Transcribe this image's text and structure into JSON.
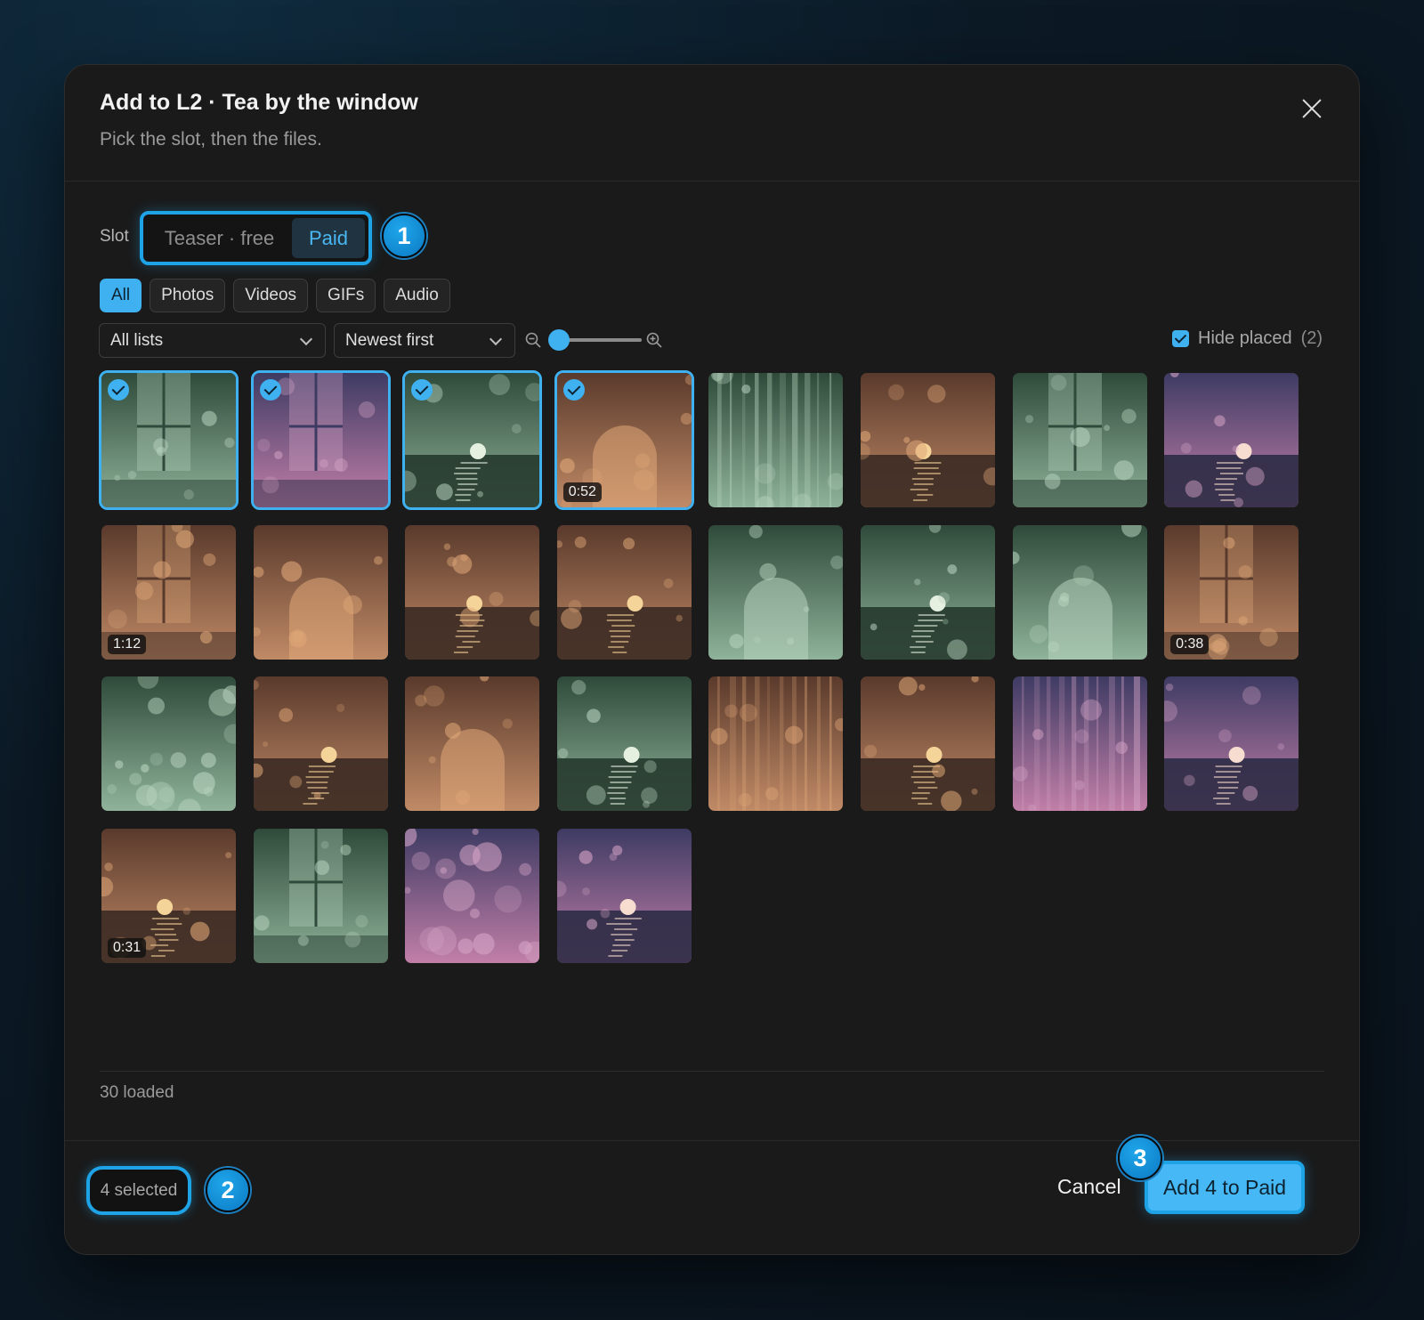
{
  "dialog": {
    "title": "Add to L2 · Tea by the window",
    "subtitle": "Pick the slot, then the files."
  },
  "slot": {
    "label": "Slot",
    "options": [
      "Teaser · free",
      "Paid"
    ],
    "selected": "Paid"
  },
  "steps": [
    "1",
    "2",
    "3"
  ],
  "filters": {
    "tabs": [
      "All",
      "Photos",
      "Videos",
      "GIFs",
      "Audio"
    ],
    "active": "All",
    "list_select": "All lists",
    "sort_select": "Newest first",
    "zoom_level": 0
  },
  "hide_placed": {
    "label": "Hide placed",
    "count": "(2)",
    "checked": true
  },
  "media": [
    {
      "theme": "green",
      "motif": "window",
      "selected": true,
      "duration": ""
    },
    {
      "theme": "purple",
      "motif": "window",
      "selected": true,
      "duration": ""
    },
    {
      "theme": "green",
      "motif": "sunset",
      "selected": true,
      "duration": ""
    },
    {
      "theme": "amber",
      "motif": "arch",
      "selected": true,
      "duration": "0:52"
    },
    {
      "theme": "green",
      "motif": "rain",
      "selected": false,
      "duration": ""
    },
    {
      "theme": "amber",
      "motif": "sunset",
      "selected": false,
      "duration": ""
    },
    {
      "theme": "green",
      "motif": "window",
      "selected": false,
      "duration": ""
    },
    {
      "theme": "purple",
      "motif": "sunset",
      "selected": false,
      "duration": ""
    },
    {
      "theme": "amber",
      "motif": "window",
      "selected": false,
      "duration": "1:12"
    },
    {
      "theme": "amber",
      "motif": "arch",
      "selected": false,
      "duration": ""
    },
    {
      "theme": "amber",
      "motif": "sunset",
      "selected": false,
      "duration": ""
    },
    {
      "theme": "amber",
      "motif": "sunset",
      "selected": false,
      "duration": ""
    },
    {
      "theme": "green",
      "motif": "arch",
      "selected": false,
      "duration": ""
    },
    {
      "theme": "green",
      "motif": "sunset",
      "selected": false,
      "duration": ""
    },
    {
      "theme": "green",
      "motif": "arch",
      "selected": false,
      "duration": ""
    },
    {
      "theme": "amber",
      "motif": "window",
      "selected": false,
      "duration": "0:38"
    },
    {
      "theme": "green",
      "motif": "bokeh",
      "selected": false,
      "duration": ""
    },
    {
      "theme": "amber",
      "motif": "sunset",
      "selected": false,
      "duration": ""
    },
    {
      "theme": "amber",
      "motif": "arch",
      "selected": false,
      "duration": ""
    },
    {
      "theme": "green",
      "motif": "sunset",
      "selected": false,
      "duration": ""
    },
    {
      "theme": "amber",
      "motif": "rain",
      "selected": false,
      "duration": ""
    },
    {
      "theme": "amber",
      "motif": "sunset",
      "selected": false,
      "duration": ""
    },
    {
      "theme": "purple",
      "motif": "rain",
      "selected": false,
      "duration": ""
    },
    {
      "theme": "purple",
      "motif": "sunset",
      "selected": false,
      "duration": ""
    },
    {
      "theme": "amber",
      "motif": "sunset",
      "selected": false,
      "duration": "0:31"
    },
    {
      "theme": "green",
      "motif": "window",
      "selected": false,
      "duration": ""
    },
    {
      "theme": "purple",
      "motif": "bokeh",
      "selected": false,
      "duration": ""
    },
    {
      "theme": "purple",
      "motif": "sunset",
      "selected": false,
      "duration": ""
    }
  ],
  "status": {
    "loaded": "30 loaded",
    "selected_count": "4 selected"
  },
  "actions": {
    "cancel": "Cancel",
    "primary": "Add 4 to Paid"
  },
  "colors": {
    "accent": "#3fb0f0",
    "highlight_ring": "#1ea3e6",
    "background": "#1a1a1a"
  },
  "icons": {
    "close": "close-icon",
    "zoom_out": "zoom-out-icon",
    "zoom_in": "zoom-in-icon",
    "check": "check-icon",
    "chevron": "chevron-down-icon"
  }
}
